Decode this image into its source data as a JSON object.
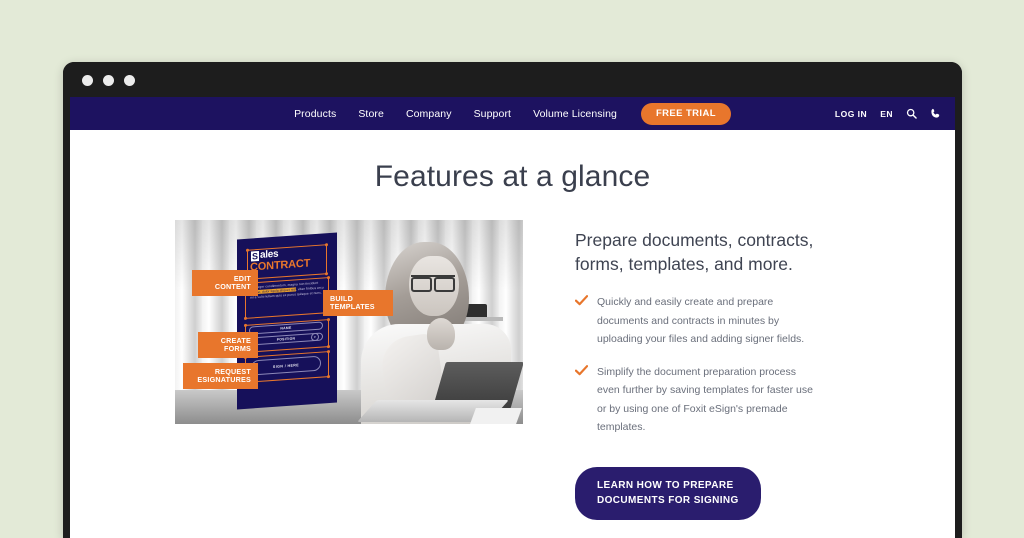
{
  "browser": {
    "dots": [
      "close-dot",
      "minimize-dot",
      "maximize-dot"
    ]
  },
  "nav": {
    "links": [
      {
        "label": "Products"
      },
      {
        "label": "Store"
      },
      {
        "label": "Company"
      },
      {
        "label": "Support"
      },
      {
        "label": "Volume Licensing"
      }
    ],
    "cta": "FREE TRIAL",
    "login": "LOG IN",
    "language": "EN",
    "icons": [
      "search-icon",
      "phone-icon"
    ]
  },
  "page": {
    "title": "Features at a glance"
  },
  "illustration": {
    "alt": "Woman at a laptop with a sales contract document overlay",
    "document": {
      "logo_mark": "S",
      "logo_word": "ales",
      "heading": "CONTRACT",
      "body_before": "Integer condimentum, magna non tincidunt ",
      "body_highlight": "pulvinar, dolor ligula aliquet nisl",
      "body_after": ", vitae finibus arcu mi a velit nullam quis ex purus quisque et nunc.",
      "fields": [
        {
          "label": "NAME"
        },
        {
          "label": "POSITION"
        }
      ],
      "sign_label": "SIGN / HERE"
    },
    "tags": [
      {
        "id": "edit-content",
        "line1": "EDIT",
        "line2": "CONTENT"
      },
      {
        "id": "build-templates",
        "line1": "BUILD",
        "line2": "TEMPLATES"
      },
      {
        "id": "create-forms",
        "line1": "CREATE",
        "line2": "FORMS"
      },
      {
        "id": "request-esignatures",
        "line1": "REQUEST",
        "line2": "ESIGNATURES"
      }
    ]
  },
  "feature": {
    "heading": "Prepare documents, contracts, forms, templates, and more.",
    "bullets": [
      "Quickly and easily create and prepare documents and contracts in minutes by uploading your files and adding signer fields.",
      "Simplify the document preparation process even further by saving templates for faster use or by using one of Foxit eSign's premade templates."
    ],
    "cta_line1": "LEARN HOW TO PREPARE",
    "cta_line2": "DOCUMENTS FOR SIGNING"
  },
  "colors": {
    "page_background": "#e3ead7",
    "browser_chrome": "#1d1d1d",
    "nav_background": "#1d1260",
    "accent_orange": "#e8762c",
    "cta_navy": "#2a1d6e",
    "heading_text": "#3a3f4d",
    "body_text": "#6a6f7b"
  }
}
